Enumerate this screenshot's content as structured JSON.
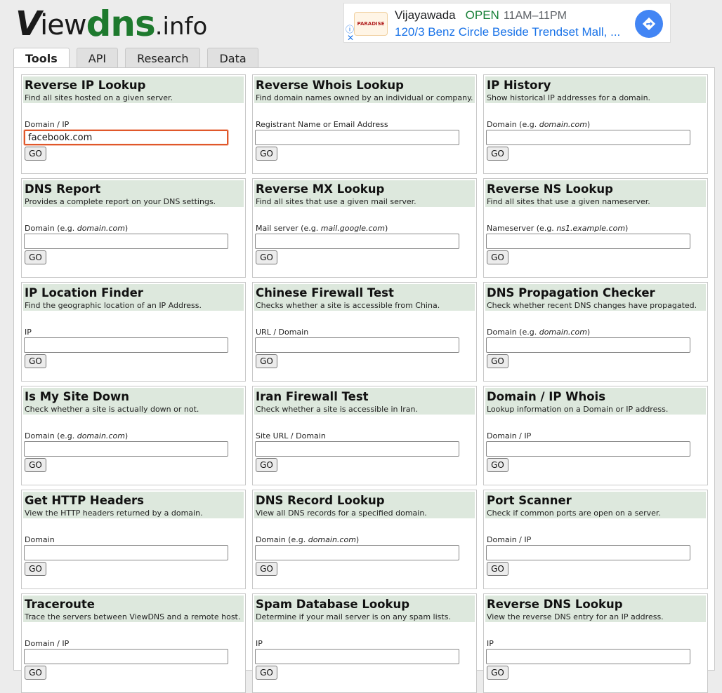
{
  "logo": {
    "v": "V",
    "iew": "iew",
    "dns": "dns",
    "info": ".info"
  },
  "ad": {
    "brand": "PARADISE",
    "name": "Vijayawada",
    "status": "OPEN",
    "hours": "11AM–11PM",
    "address": "120/3 Benz Circle Beside Trendset Mall, ...",
    "info_icon": "info-icon",
    "close_icon": "close-icon",
    "directions_icon": "directions-icon"
  },
  "tabs": [
    {
      "label": "Tools",
      "active": true
    },
    {
      "label": "API",
      "active": false
    },
    {
      "label": "Research",
      "active": false
    },
    {
      "label": "Data",
      "active": false
    }
  ],
  "go_label": "GO",
  "tools": [
    {
      "title": "Reverse IP Lookup",
      "desc": "Find all sites hosted on a given server.",
      "label": "Domain / IP",
      "example": "",
      "label_suffix": "",
      "value": "facebook.com"
    },
    {
      "title": "Reverse Whois Lookup",
      "desc": "Find domain names owned by an individual or company.",
      "label": "Registrant Name or Email Address",
      "example": "",
      "label_suffix": "",
      "value": ""
    },
    {
      "title": "IP History",
      "desc": "Show historical IP addresses for a domain.",
      "label": "Domain (e.g. ",
      "example": "domain.com",
      "label_suffix": ")",
      "value": ""
    },
    {
      "title": "DNS Report",
      "desc": "Provides a complete report on your DNS settings.",
      "label": "Domain (e.g. ",
      "example": "domain.com",
      "label_suffix": ")",
      "value": ""
    },
    {
      "title": "Reverse MX Lookup",
      "desc": "Find all sites that use a given mail server.",
      "label": "Mail server (e.g. ",
      "example": "mail.google.com",
      "label_suffix": ")",
      "value": ""
    },
    {
      "title": "Reverse NS Lookup",
      "desc": "Find all sites that use a given nameserver.",
      "label": "Nameserver (e.g. ",
      "example": "ns1.example.com",
      "label_suffix": ")",
      "value": ""
    },
    {
      "title": "IP Location Finder",
      "desc": "Find the geographic location of an IP Address.",
      "label": "IP",
      "example": "",
      "label_suffix": "",
      "value": ""
    },
    {
      "title": "Chinese Firewall Test",
      "desc": "Checks whether a site is accessible from China.",
      "label": "URL / Domain",
      "example": "",
      "label_suffix": "",
      "value": ""
    },
    {
      "title": "DNS Propagation Checker",
      "desc": "Check whether recent DNS changes have propagated.",
      "label": "Domain (e.g. ",
      "example": "domain.com",
      "label_suffix": ")",
      "value": ""
    },
    {
      "title": "Is My Site Down",
      "desc": "Check whether a site is actually down or not.",
      "label": "Domain (e.g. ",
      "example": "domain.com",
      "label_suffix": ")",
      "value": ""
    },
    {
      "title": "Iran Firewall Test",
      "desc": "Check whether a site is accessible in Iran.",
      "label": "Site URL / Domain",
      "example": "",
      "label_suffix": "",
      "value": ""
    },
    {
      "title": "Domain / IP Whois",
      "desc": "Lookup information on a Domain or IP address.",
      "label": "Domain / IP",
      "example": "",
      "label_suffix": "",
      "value": ""
    },
    {
      "title": "Get HTTP Headers",
      "desc": "View the HTTP headers returned by a domain.",
      "label": "Domain",
      "example": "",
      "label_suffix": "",
      "value": ""
    },
    {
      "title": "DNS Record Lookup",
      "desc": "View all DNS records for a specified domain.",
      "label": "Domain (e.g. ",
      "example": "domain.com",
      "label_suffix": ")",
      "value": ""
    },
    {
      "title": "Port Scanner",
      "desc": "Check if common ports are open on a server.",
      "label": "Domain / IP",
      "example": "",
      "label_suffix": "",
      "value": ""
    },
    {
      "title": "Traceroute",
      "desc": "Trace the servers between ViewDNS and a remote host.",
      "label": "Domain / IP",
      "example": "",
      "label_suffix": "",
      "value": ""
    },
    {
      "title": "Spam Database Lookup",
      "desc": "Determine if your mail server is on any spam lists.",
      "label": "IP",
      "example": "",
      "label_suffix": "",
      "value": ""
    },
    {
      "title": "Reverse DNS Lookup",
      "desc": "View the reverse DNS entry for an IP address.",
      "label": "IP",
      "example": "",
      "label_suffix": "",
      "value": ""
    }
  ]
}
